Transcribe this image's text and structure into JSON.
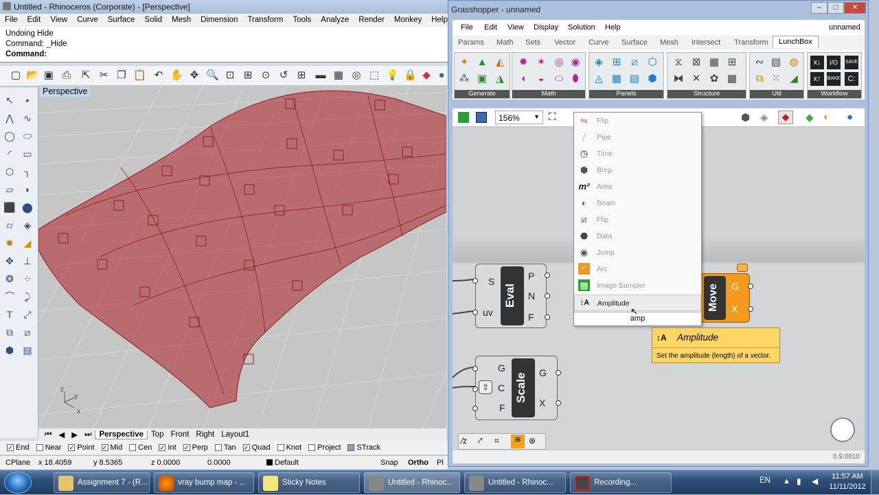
{
  "rhino": {
    "title": "Untitled - Rhinoceros (Corporate) - [Perspective]",
    "menu": [
      "File",
      "Edit",
      "View",
      "Curve",
      "Surface",
      "Solid",
      "Mesh",
      "Dimension",
      "Transform",
      "Tools",
      "Analyze",
      "Render",
      "Monkey",
      "Help"
    ],
    "command_history": [
      "Undoing Hide",
      "Command: _Hide"
    ],
    "command_prompt": "Command:",
    "viewport_label": "Perspective",
    "axis_labels": {
      "z": "z",
      "y": "y",
      "x": "x"
    },
    "view_tabs": [
      "Perspective",
      "Top",
      "Front",
      "Right",
      "Layout1"
    ],
    "active_tab": "Perspective",
    "osnaps": [
      {
        "label": "End",
        "checked": true
      },
      {
        "label": "Near",
        "checked": false
      },
      {
        "label": "Point",
        "checked": true
      },
      {
        "label": "Mid",
        "checked": true
      },
      {
        "label": "Cen",
        "checked": false
      },
      {
        "label": "Int",
        "checked": true
      },
      {
        "label": "Perp",
        "checked": true
      },
      {
        "label": "Tan",
        "checked": false
      },
      {
        "label": "Quad",
        "checked": true
      },
      {
        "label": "Knot",
        "checked": false
      },
      {
        "label": "Project",
        "checked": false
      },
      {
        "label": "STrack",
        "checked": false
      }
    ],
    "status": {
      "cplane": "CPlane",
      "x": "x 18.4059",
      "y": "y 8.5365",
      "z": "z 0.0000",
      "dist": "0.0000",
      "layer": "Default",
      "snap": "Snap",
      "ortho": "Ortho",
      "planar": "Pl"
    }
  },
  "grasshopper": {
    "title": "Grasshopper - unnamed",
    "doc_name": "unnamed",
    "menu": [
      "File",
      "Edit",
      "View",
      "Display",
      "Solution",
      "Help"
    ],
    "tabs": [
      "Params",
      "Math",
      "Sets",
      "Vector",
      "Curve",
      "Surface",
      "Mesh",
      "Intersect",
      "Transform",
      "LunchBox"
    ],
    "active_tab": "LunchBox",
    "ribbon_groups": [
      "Generate",
      "Math",
      "Panels",
      "Structure",
      "Util",
      "Workflow"
    ],
    "zoom": "156%",
    "version": "0.9.0010",
    "components": {
      "eval": {
        "name": "Eval",
        "inputs": [
          "S",
          "uv"
        ],
        "outputs": [
          "P",
          "N",
          "F"
        ]
      },
      "scale": {
        "name": "Scale",
        "inputs": [
          "G",
          "C",
          "F"
        ],
        "outputs": [
          "G",
          "X"
        ]
      },
      "move": {
        "name": "Move",
        "outputs": [
          "G",
          "X"
        ]
      }
    }
  },
  "search_dropdown": {
    "items": [
      "Flip",
      "Pipe",
      "Time",
      "Brep",
      "Area",
      "Seam",
      "Flip",
      "Data",
      "Jump",
      "Arc",
      "Image Sampler",
      "Amplitude"
    ],
    "selected": "Amplitude",
    "query": "amp"
  },
  "tooltip": {
    "title": "Amplitude",
    "description": "Set the amplitude (length) of a vector."
  },
  "taskbar": {
    "items": [
      "Assignment 7 - (R...",
      "vray bump map - ...",
      "Sticky Notes",
      "Untitled - Rhinoc...",
      "Untitled - Rhinoc...",
      "Recording..."
    ],
    "lang": "EN",
    "time": "11:57 AM",
    "date": "11/11/2012"
  }
}
